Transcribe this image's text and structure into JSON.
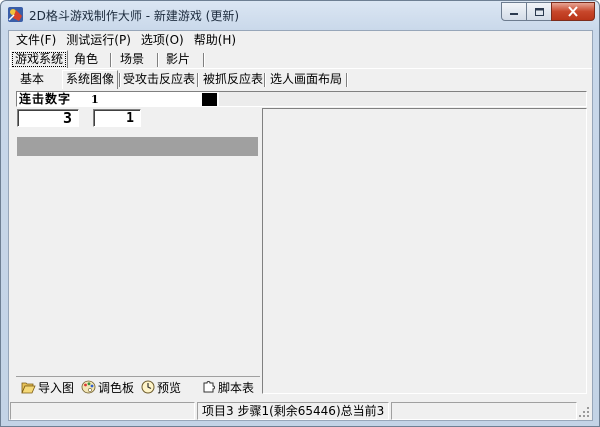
{
  "window": {
    "title": "2D格斗游戏制作大师 - 新建游戏 (更新)"
  },
  "menu": [
    "文件(F)",
    "测试运行(P)",
    "选项(O)",
    "帮助(H)"
  ],
  "tabs_top": [
    "游戏系统",
    "角色",
    "场景",
    "影片"
  ],
  "tabs_sub": [
    "基本",
    "系统图像",
    "受攻击反应表",
    "被抓反应表",
    "选人画面布局"
  ],
  "combo": {
    "label": "连击数字",
    "value": "1",
    "swatch_color": "#000000"
  },
  "number_boxes": [
    "3",
    "1"
  ],
  "toolbar": {
    "import_label": "导入图",
    "palette_label": "调色板",
    "preview_label": "预览",
    "script_label": "脚本表"
  },
  "status": {
    "text": "项目3 步骤1(剩余65446)总当前3"
  },
  "colors": {
    "preview_bar": "#a0a0a0",
    "close_button": "#c8472b"
  }
}
